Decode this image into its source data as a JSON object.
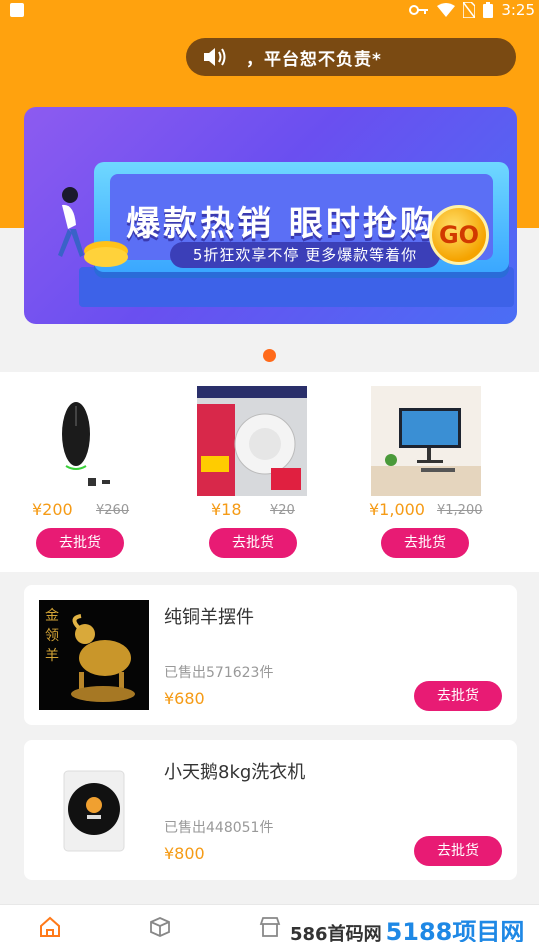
{
  "status_bar": {
    "time": "3:25"
  },
  "notice": {
    "text": "，平台恕不负责*"
  },
  "banner": {
    "title": "爆款热销 眼时抢购",
    "subtitle": "5折狂欢享不停 更多爆款等着你",
    "go": "GO"
  },
  "featured": [
    {
      "icon": "mouse-image",
      "price": "¥200",
      "old_price": "¥260",
      "button": "去批货"
    },
    {
      "icon": "smoke-detector-image",
      "price": "¥18",
      "old_price": "¥20",
      "button": "去批货"
    },
    {
      "icon": "monitor-image",
      "price": "¥1,000",
      "old_price": "¥1,200",
      "button": "去批货"
    }
  ],
  "products": [
    {
      "icon": "brass-goat-image",
      "name": "纯铜羊摆件",
      "sold": "已售出571623件",
      "price": "¥680",
      "button": "去批货"
    },
    {
      "icon": "washing-machine-image",
      "name": "小天鹅8kg洗衣机",
      "sold": "已售出448051件",
      "price": "¥800",
      "button": "去批货"
    }
  ],
  "watermark": {
    "text": "586首码网",
    "big": "5188项目网"
  },
  "colors": {
    "header": "#ffa20e",
    "accent_button": "#e81b74",
    "price": "#f59b16"
  }
}
